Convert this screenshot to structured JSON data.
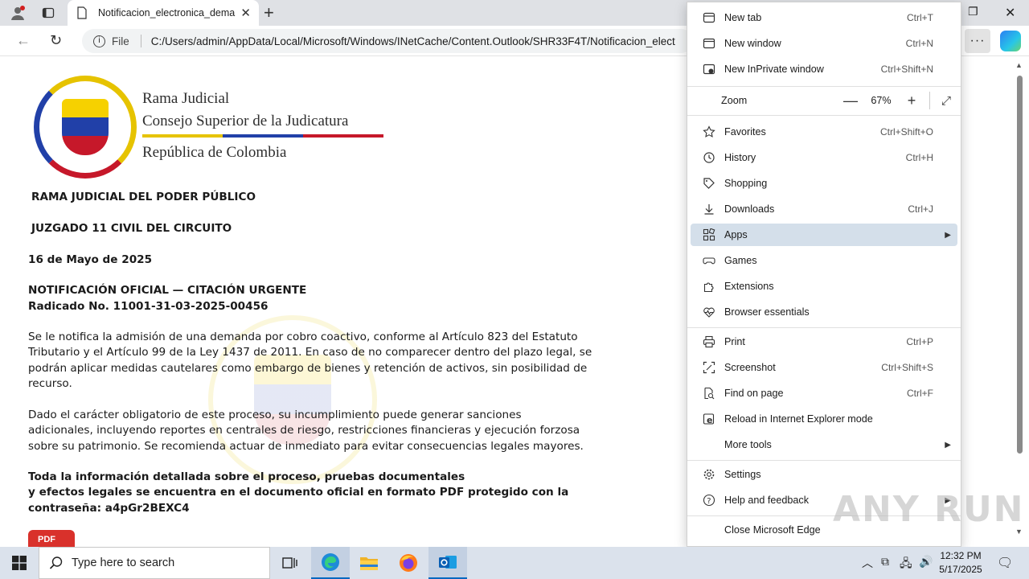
{
  "browser": {
    "tab_title": "Notificacion_electronica_demand",
    "address_scheme_label": "File",
    "address_url": "C:/Users/admin/AppData/Local/Microsoft/Windows/INetCache/Content.Outlook/SHR33F4T/Notificacion_elect"
  },
  "document": {
    "org": {
      "line1": "Rama Judicial",
      "line2": "Consejo Superior de la Judicatura",
      "line3": "República de Colombia"
    },
    "heading1": "RAMA JUDICIAL DEL PODER PÚBLICO",
    "heading2": "JUZGADO 11 CIVIL DEL CIRCUITO",
    "date": "16 de Mayo de 2025",
    "notice_title": "NOTIFICACIÓN OFICIAL — CITACIÓN URGENTE",
    "radicado": "Radicado No. 11001-31-03-2025-00456",
    "para1": [
      "Se le notifica la admisión de una demanda por cobro coactivo, conforme al Artículo 823 del Estatuto",
      "Tributario y el Artículo 99 de la Ley 1437 de 2011. En caso de no comparecer dentro del plazo legal, se",
      "podrán aplicar medidas cautelares como embargo de bienes y retención de activos, sin posibilidad de",
      "recurso."
    ],
    "para2": [
      "Dado el carácter obligatorio de este proceso, su incumplimiento puede generar sanciones",
      "adicionales, incluyendo reportes en centrales de riesgo, restricciones financieras y ejecución forzosa",
      "sobre su patrimonio. Se recomienda actuar de inmediato para evitar consecuencias legales mayores."
    ],
    "para3": [
      "Toda la información detallada sobre el proceso, pruebas documentales",
      "y efectos legales se encuentra en el documento oficial en formato PDF protegido con la",
      "contraseña:  a4pGr2BEXC4"
    ],
    "pdf_label": "PDF",
    "seal_colors": {
      "yellow": "#e6c300",
      "blue": "#2140a8",
      "red": "#c6182a"
    }
  },
  "menu": {
    "items_top": [
      {
        "label": "New tab",
        "shortcut": "Ctrl+T",
        "icon": "new-tab-icon"
      },
      {
        "label": "New window",
        "shortcut": "Ctrl+N",
        "icon": "new-window-icon"
      },
      {
        "label": "New InPrivate window",
        "shortcut": "Ctrl+Shift+N",
        "icon": "inprivate-icon"
      }
    ],
    "zoom": {
      "label": "Zoom",
      "value": "67%",
      "minus": "—",
      "plus": "+"
    },
    "items_mid": [
      {
        "label": "Favorites",
        "shortcut": "Ctrl+Shift+O",
        "icon": "star-icon"
      },
      {
        "label": "History",
        "shortcut": "Ctrl+H",
        "icon": "history-icon"
      },
      {
        "label": "Shopping",
        "shortcut": "",
        "icon": "tag-icon"
      },
      {
        "label": "Downloads",
        "shortcut": "Ctrl+J",
        "icon": "download-icon"
      },
      {
        "label": "Apps",
        "shortcut": "",
        "icon": "apps-icon"
      },
      {
        "label": "Games",
        "shortcut": "",
        "icon": "games-icon"
      },
      {
        "label": "Extensions",
        "shortcut": "",
        "icon": "extensions-icon"
      },
      {
        "label": "Browser essentials",
        "shortcut": "",
        "icon": "heart-pulse-icon"
      }
    ],
    "items_tools": [
      {
        "label": "Print",
        "shortcut": "Ctrl+P",
        "icon": "print-icon"
      },
      {
        "label": "Screenshot",
        "shortcut": "Ctrl+Shift+S",
        "icon": "screenshot-icon"
      },
      {
        "label": "Find on page",
        "shortcut": "Ctrl+F",
        "icon": "find-icon"
      },
      {
        "label": "Reload in Internet Explorer mode",
        "shortcut": "",
        "icon": "ie-icon"
      },
      {
        "label": "More tools",
        "shortcut": "",
        "icon": ""
      }
    ],
    "items_bottom": [
      {
        "label": "Settings",
        "shortcut": "",
        "icon": "gear-icon"
      },
      {
        "label": "Help and feedback",
        "shortcut": "",
        "icon": "help-icon"
      },
      {
        "label": "Close Microsoft Edge",
        "shortcut": "",
        "icon": ""
      }
    ]
  },
  "watermark_text": "ANY RUN",
  "taskbar": {
    "search_placeholder": "Type here to search",
    "time": "12:32 PM",
    "date": "5/17/2025"
  }
}
